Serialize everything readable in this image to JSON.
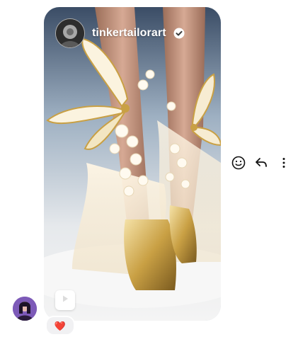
{
  "message": {
    "author_name": "tinkertailorart",
    "reaction_emoji": "❤️"
  },
  "icons": {
    "author_verified": "verified-badge-icon",
    "play": "play-icon",
    "react": "smiley-icon",
    "reply": "reply-arrow-icon",
    "more": "more-vertical-icon"
  },
  "colors": {
    "icon": "#111111",
    "author_text": "#ffffff",
    "reaction_bg": "#f1f1f3"
  }
}
